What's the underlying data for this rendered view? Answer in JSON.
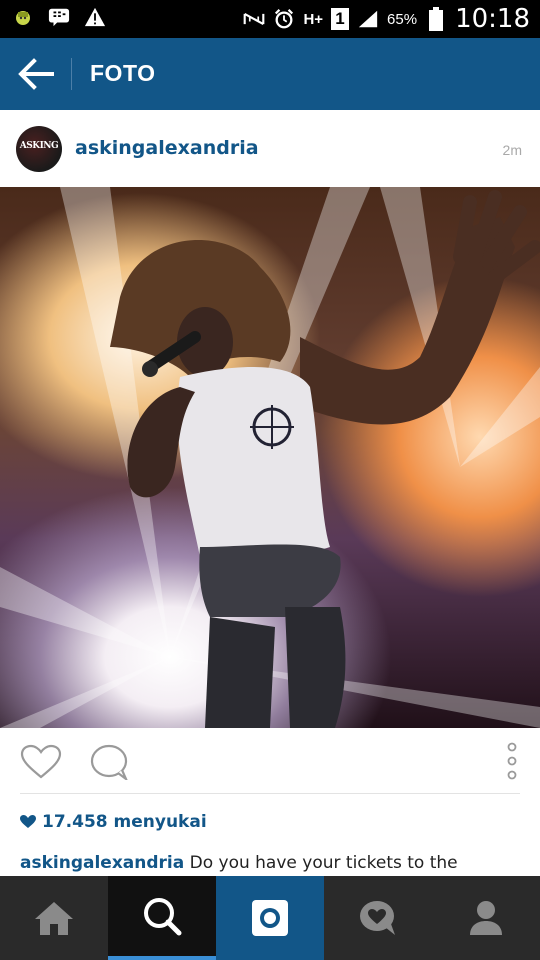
{
  "status_bar": {
    "battery_percent": "65%",
    "time": "10:18",
    "network_label": "H+",
    "sim_slot": "1"
  },
  "app_bar": {
    "title": "FOTO"
  },
  "post": {
    "username": "askingalexandria",
    "time_ago": "2m",
    "avatar_text": "ASKING",
    "likes_text": "17.458 menyukai",
    "caption_user": "askingalexandria",
    "caption_text": "Do you have your tickets to the"
  },
  "colors": {
    "brand_blue": "#125688",
    "status_bar": "#000000",
    "tab_bar": "#2a2a2a"
  },
  "tabs": [
    {
      "name": "home",
      "icon": "home-icon"
    },
    {
      "name": "search",
      "icon": "search-icon",
      "selected": true
    },
    {
      "name": "camera",
      "icon": "camera-icon"
    },
    {
      "name": "activity",
      "icon": "activity-icon"
    },
    {
      "name": "profile",
      "icon": "profile-icon"
    }
  ]
}
